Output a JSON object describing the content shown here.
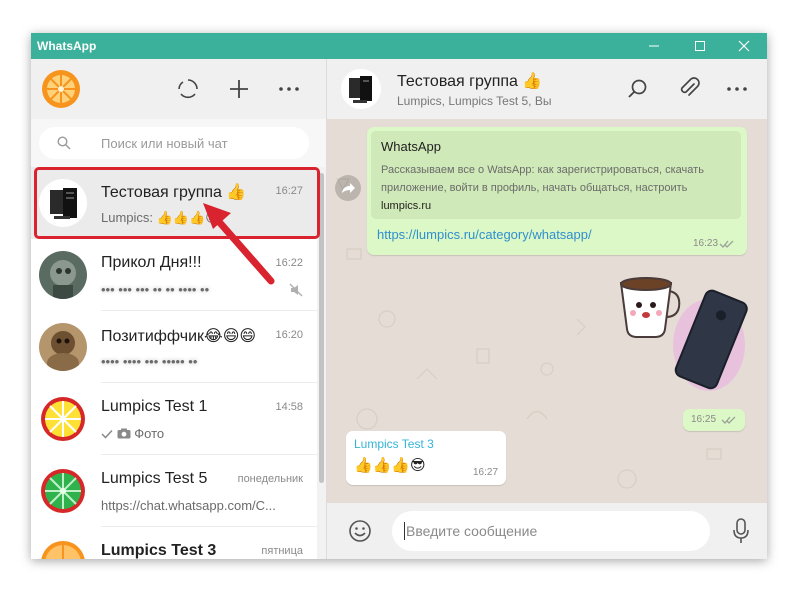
{
  "window": {
    "title": "WhatsApp",
    "accent_color": "#3bb09a",
    "controls": [
      "minimize-icon",
      "maximize-icon",
      "close-icon"
    ]
  },
  "sidebar": {
    "header_icons": [
      "status-icon",
      "new-chat-icon",
      "menu-icon"
    ],
    "search_placeholder": "Поиск или новый чат",
    "chats": [
      {
        "name": "Тестовая группа 👍",
        "time": "16:27",
        "preview": "Lumpics: 👍👍👍😎",
        "selected": true
      },
      {
        "name": "Прикол Дня!!!",
        "time": "16:22",
        "preview": "",
        "muted": true
      },
      {
        "name": "Позитиффчик😂😄😄",
        "time": "16:20",
        "preview": ""
      },
      {
        "name": "Lumpics Test 1",
        "time": "14:58",
        "preview": "Фото",
        "sent_check": true
      },
      {
        "name": "Lumpics Test 5",
        "time": "понедельник",
        "preview": "https://chat.whatsapp.com/C..."
      },
      {
        "name": "Lumpics Test 3",
        "time": "пятница",
        "preview": ""
      }
    ]
  },
  "conversation": {
    "name": "Тестовая группа 👍",
    "members": "Lumpics, Lumpics Test 5, Вы",
    "header_icons": [
      "search-icon",
      "attach-icon",
      "menu-icon"
    ],
    "messages": [
      {
        "type": "link",
        "preview_title": "WhatsApp",
        "preview_desc": "Рассказываем все о WatsApp: как зарегистрироваться, скачать приложение, войти в профиль, начать общаться, настроить",
        "preview_site": "lumpics.ru",
        "link": "https://lumpics.ru/category/whatsapp/",
        "time": "16:23"
      },
      {
        "type": "sticker",
        "time": "16:25"
      },
      {
        "type": "incoming",
        "sender": "Lumpics Test 3",
        "text": "👍👍👍😎",
        "time": "16:27",
        "sender_color": "#35b4d6"
      }
    ],
    "compose_placeholder": "Введите сообщение",
    "compose_icons": [
      "emoji-icon",
      "microphone-icon"
    ]
  },
  "annotation": {
    "highlight_color": "#d9232e"
  }
}
